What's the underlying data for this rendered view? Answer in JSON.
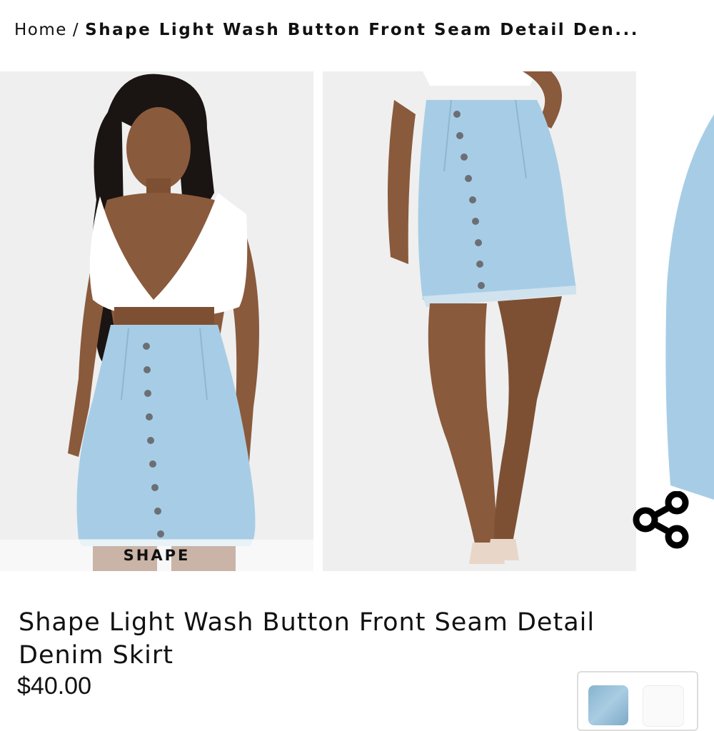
{
  "breadcrumb": {
    "home": "Home",
    "separator": "/",
    "current": "Shape Light Wash Button Front Seam Detail Den..."
  },
  "gallery": {
    "slides": [
      {
        "label": "model front view"
      },
      {
        "label": "skirt close-up"
      },
      {
        "label": "side view partial"
      }
    ],
    "brand_tag": "SHAPE"
  },
  "product": {
    "title": "Shape Light Wash Button Front Seam Detail Denim Skirt",
    "price": "$40.00"
  },
  "icons": {
    "share": "share-icon"
  },
  "colors": {
    "denim": "#a7cde6",
    "background": "#efefef",
    "text": "#111111"
  }
}
